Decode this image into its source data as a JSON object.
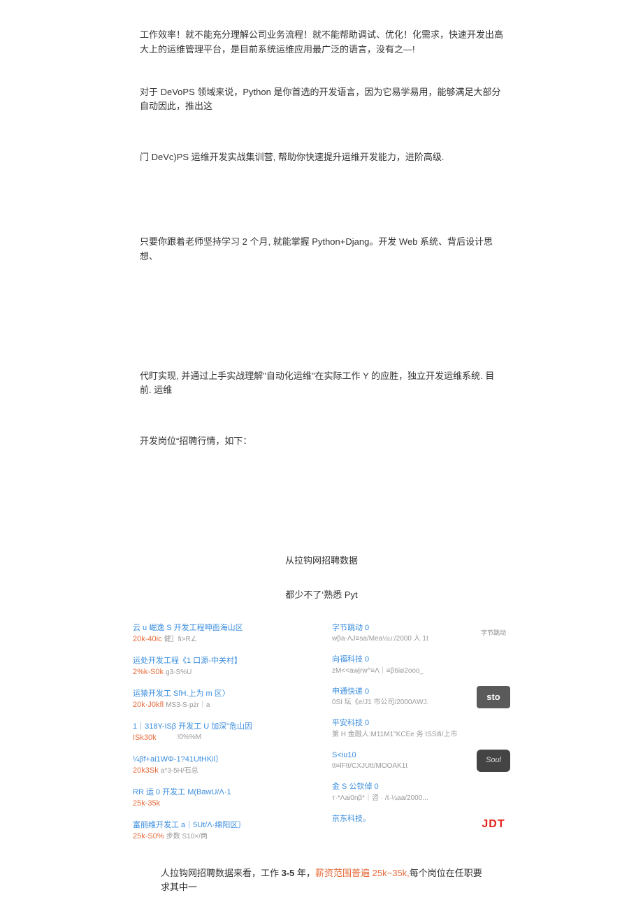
{
  "paragraphs": {
    "p1": "工作效率！就不能充分理解公司业务流程！就不能帮助调试、优化！化需求，快速开发出高大上的运维管理平台，是目前系统运维应用最广泛的语言，没有之—!",
    "p2": "对于 DeVoPS 领域来说，Python 是你首选的开发语言，因为它易学易用，能够满足大部分自动因此，推出这",
    "p3": "门 DeVc)PS 运维开发实战集训营, 帮助你快速提升运维开发能力，进阶高级.",
    "p4": "只要你跟着老师坚持学习 2 个月, 就能掌握 Python+Djang。开发 Web 系统、背后设计思想、",
    "p5": "代盯实现, 并通过上手实战理解\"自动化运维\"在实际工作 Y 的应胜，独立开发运维系统. 目前. 运维",
    "p6": "开发岗位“招聘行情，如下：",
    "heading1": "从拉钩网招聘数据",
    "heading2": "都少不了‘熟悉 Pyt"
  },
  "jobs_left": [
    {
      "title": "云 u 崛逸 S 开发工程呻面海山区",
      "salary": "20k-40ic",
      "meta": "健］fi>R∠"
    },
    {
      "title": "运处开发工程《1 口源-中关村】",
      "salary": "2%k-S0k",
      "meta": "g3-S%U"
    },
    {
      "title": "运猿开发工 SfH.上为 m 区〉",
      "salary": "20k·J0kfl",
      "meta": "MS3-S·pżr｜a"
    },
    {
      "title": "1｜318Y-ISβ 开发工 U 加深”危山因",
      "salary": "ISk30k",
      "meta": "!0%%M"
    },
    {
      "title": "¼βf+ai1WΦ-1?41UtHKil〕",
      "salary": "20k3Sk",
      "meta": "a*3-5H/石总"
    },
    {
      "title": "RR 运 0 开发工 M(BawU/Λ·1",
      "salary": "25k-35k",
      "meta": ""
    },
    {
      "title": "富丽维开发工 a｜5Ut/Λ·绵阳区〕",
      "salary": "25k-S0%",
      "meta": "步数 S10×/两"
    }
  ],
  "jobs_right": [
    {
      "company": "字节跳动 0",
      "meta": "wβa·ΛJ≡sa/Mea½u:/2000 人 1t",
      "logo": "byte"
    },
    {
      "company": "向福科技 0",
      "meta": "zM<<awjrw^≡Λ｜≡β6iø2ooo_",
      "logo": ""
    },
    {
      "company": "申通快递 0",
      "meta": "0SI 坛《e/J1 市公司/2000ΛWJ.",
      "logo": "sto"
    },
    {
      "company": "平安科技 0",
      "meta": "第 H 金融人:M11M1\"KCEe 务 ISSifi/上市",
      "logo": ""
    },
    {
      "company": "S<iu10",
      "meta": "tt≡lFtt/CXJUtt/MOOAK1t",
      "logo": "soul"
    },
    {
      "company": "金 S 公钦倬 0",
      "meta": "т·*Λai0nβ*｜咨 · /t·¼aa/2000...",
      "logo": ""
    },
    {
      "company": "京东科技。",
      "meta": "",
      "logo": "jdt"
    }
  ],
  "bottom": {
    "prefix": "人拉钩网招聘数据来看，工作 ",
    "years": "3-5",
    "mid": " 年，",
    "salary_label": "薪资范围普遍 25k~35k,",
    "suffix": "每个岗位在任职要求其中一"
  },
  "logo_text": {
    "sto": "sto",
    "soul": "Soul",
    "jdt": "JDT",
    "byte": "字节跳动"
  }
}
